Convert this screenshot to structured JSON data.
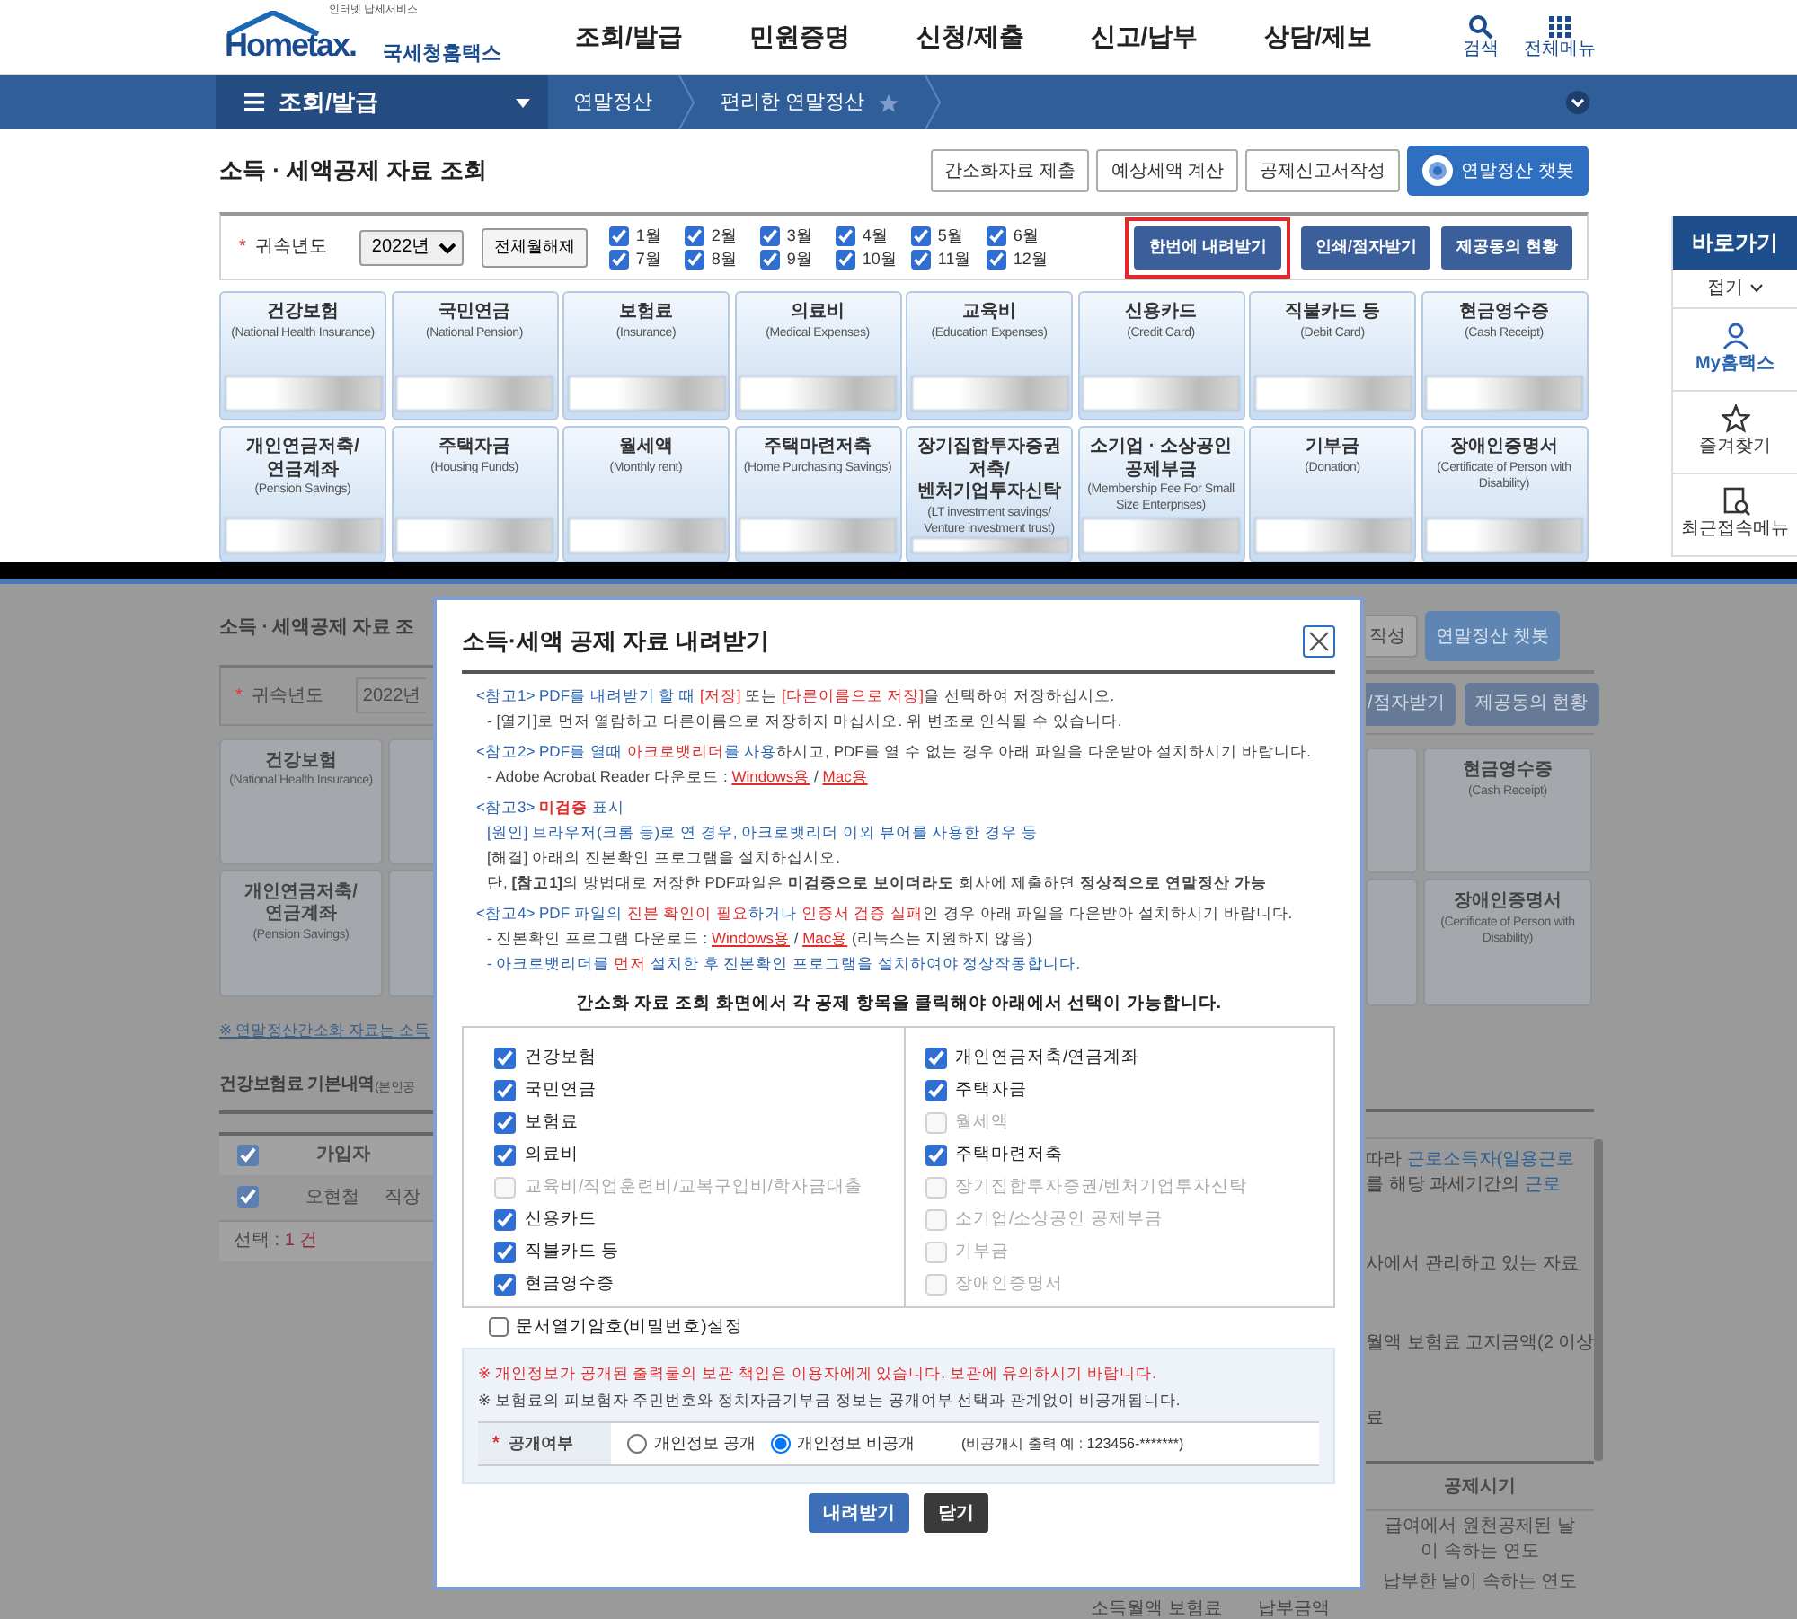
{
  "header": {
    "tagline": "인터넷 납세서비스",
    "logo": "Hometax.",
    "logo_korean": "국세청홈택스",
    "menu": [
      "조회/발급",
      "민원증명",
      "신청/제출",
      "신고/납부",
      "상담/제보"
    ],
    "utilities": [
      {
        "label": "검색",
        "kind": "search"
      },
      {
        "label": "전체메뉴",
        "kind": "grid"
      }
    ]
  },
  "nav": {
    "section": "조회/발급",
    "breadcrumbs": [
      "연말정산",
      "편리한 연말정산"
    ]
  },
  "page": {
    "title": "소득 · 세액공제 자료 조회",
    "actions": [
      {
        "label": "간소화자료 제출",
        "kind": "plain"
      },
      {
        "label": "예상세액 계산",
        "kind": "plain"
      },
      {
        "label": "공제신고서작성",
        "kind": "plain"
      },
      {
        "label": "연말정산 챗봇",
        "kind": "chatbot"
      }
    ],
    "filter": {
      "required_mark": "*",
      "label": "귀속년도",
      "year": "2022년",
      "clear_button": "전체월해제",
      "months": [
        {
          "label": "1월",
          "checked": true
        },
        {
          "label": "2월",
          "checked": true
        },
        {
          "label": "3월",
          "checked": true
        },
        {
          "label": "4월",
          "checked": true
        },
        {
          "label": "5월",
          "checked": true
        },
        {
          "label": "6월",
          "checked": true
        },
        {
          "label": "7월",
          "checked": true
        },
        {
          "label": "8월",
          "checked": true
        },
        {
          "label": "9월",
          "checked": true
        },
        {
          "label": "10월",
          "checked": true
        },
        {
          "label": "11월",
          "checked": true
        },
        {
          "label": "12월",
          "checked": true
        }
      ],
      "buttons": [
        {
          "label": "한번에 내려받기",
          "highlighted": true
        },
        {
          "label": "인쇄/점자받기",
          "highlighted": false
        },
        {
          "label": "제공동의 현황",
          "highlighted": false
        }
      ]
    },
    "categories": [
      {
        "title": "건강보험",
        "subtitle": "(National Health Insurance)"
      },
      {
        "title": "국민연금",
        "subtitle": "(National Pension)"
      },
      {
        "title": "보험료",
        "subtitle": "(Insurance)"
      },
      {
        "title": "의료비",
        "subtitle": "(Medical Expenses)"
      },
      {
        "title": "교육비",
        "subtitle": "(Education Expenses)"
      },
      {
        "title": "신용카드",
        "subtitle": "(Credit Card)"
      },
      {
        "title": "직불카드 등",
        "subtitle": "(Debit Card)"
      },
      {
        "title": "현금영수증",
        "subtitle": "(Cash Receipt)"
      },
      {
        "title": "개인연금저축/\n연금계좌",
        "subtitle": "(Pension Savings)"
      },
      {
        "title": "주택자금",
        "subtitle": "(Housing Funds)"
      },
      {
        "title": "월세액",
        "subtitle": "(Monthly rent)"
      },
      {
        "title": "주택마련저축",
        "subtitle": "(Home Purchasing Savings)"
      },
      {
        "title": "장기집합투자증권저축/\n벤처기업투자신탁",
        "subtitle": "(LT investment savings/ Venture investment trust)"
      },
      {
        "title": "소기업 · 소상공인\n공제부금",
        "subtitle": "(Membership Fee For Small Size Enterprises)"
      },
      {
        "title": "기부금",
        "subtitle": "(Donation)"
      },
      {
        "title": "장애인증명서",
        "subtitle": "(Certificate of Person with Disability)"
      }
    ]
  },
  "quick_menu": {
    "title": "바로가기",
    "collapse": "접기",
    "items": [
      {
        "label": "My홈택스",
        "kind": "person",
        "selected": true
      },
      {
        "label": "즐겨찾기",
        "kind": "star",
        "selected": false
      },
      {
        "label": "최근접속메뉴",
        "kind": "recent",
        "selected": false
      }
    ]
  },
  "background": {
    "left": {
      "title": "소득 · 세액공제 자료 조",
      "required_mark": "*",
      "year_label": "귀속년도",
      "year": "2022년",
      "cards": [
        {
          "title": "건강보험",
          "subtitle": "(National Health Insurance)"
        },
        {
          "title": "개인연금저축/\n연금계좌",
          "subtitle": "(Pension Savings)"
        }
      ],
      "notice_link": "※ 연말정산간소화 자료는 소득",
      "section_title": "건강보험료 기본내역",
      "section_note": "(본인공",
      "table": {
        "header_checked": true,
        "columns": [
          "가입자"
        ],
        "rows": [
          {
            "checked": true,
            "cells": [
              "오현철",
              "직장"
            ]
          }
        ],
        "footer_label": "선택 : ",
        "footer_count": "1 건"
      }
    },
    "right": {
      "actions": [
        "작성",
        "연말정산 챗봇"
      ],
      "filter_buttons": [
        "/점자받기",
        "제공동의 현황"
      ],
      "cards": [
        {
          "title": "현금영수증",
          "subtitle": "(Cash Receipt)"
        },
        {
          "title": "장애인증명서",
          "subtitle": "(Certificate of Person with Disability)"
        }
      ],
      "paragraphs": [
        [
          {
            "text": "따라 ",
            "color": "#444444"
          },
          {
            "text": "근로소득자(일용근로",
            "color": "#2f5f95"
          }
        ],
        [
          {
            "text": "를 해당 과세기간의 ",
            "color": "#444444"
          },
          {
            "text": "근로",
            "color": "#2f5f95"
          }
        ],
        [
          {
            "text": "사에서 관리하고 있는 자료",
            "color": "#444444"
          }
        ],
        [
          {
            "text": "월액 보험료 고지금액(2 이상",
            "color": "#444444"
          }
        ],
        [
          {
            "text": "료",
            "color": "#444444"
          }
        ]
      ],
      "column": "공제시기",
      "cells": [
        "급여에서 원천공제된 날이 속하는 연도",
        "납부한 날이 속하는 연도"
      ]
    },
    "bottom": [
      "소득월액 보험료",
      "납부금액"
    ]
  },
  "modal": {
    "title": "소득·세액 공제 자료 내려받기",
    "notes": [
      [
        [
          {
            "text": "<참고1> PDF를 내려받기 할 때 ",
            "color": "#2a63b0"
          },
          {
            "text": "[저장]",
            "color": "#e02b2b"
          },
          {
            "text": " 또는 ",
            "color": "#444444"
          },
          {
            "text": "[다른이름으로 저장]",
            "color": "#e02b2b"
          },
          {
            "text": "을 선택하여 저장하십시오.",
            "color": "#444444"
          }
        ],
        [
          {
            "text": "- [열기]로 먼저 열람하고 다른이름으로 저장하지 마십시오. 위 변조로 인식될 수 있습니다.",
            "color": "#444444"
          }
        ]
      ],
      [
        [
          {
            "text": "<참고2> PDF를 열때 ",
            "color": "#2a63b0"
          },
          {
            "text": "아크로뱃리더",
            "color": "#e02b2b"
          },
          {
            "text": "를 사용",
            "color": "#2a63b0"
          },
          {
            "text": "하시고, PDF를 열 수 없는 경우 아래 파일을 다운받아 설치하시기 바랍니다.",
            "color": "#444444"
          }
        ],
        [
          {
            "text": "- Adobe Acrobat Reader 다운로드 : ",
            "color": "#444444"
          },
          {
            "text": "Windows용",
            "color": "#e02b2b",
            "link": true
          },
          {
            "text": " / ",
            "color": "#444444"
          },
          {
            "text": "Mac용",
            "color": "#e02b2b",
            "link": true
          }
        ]
      ],
      [
        [
          {
            "text": "<참고3> ",
            "color": "#2a63b0"
          },
          {
            "text": "미검증",
            "color": "#e02b2b",
            "bold": true
          },
          {
            "text": " 표시",
            "color": "#2a63b0"
          }
        ],
        [
          {
            "text": "[원인] 브라우저(크롬 등)로 연 경우, 아크로뱃리더 이외 뷰어를 사용한 경우 등",
            "color": "#2a63b0"
          }
        ],
        [
          {
            "text": "[해결] 아래의 진본확인 프로그램을 설치하십시오.",
            "color": "#444444"
          }
        ],
        [
          {
            "text": "단, ",
            "color": "#444444"
          },
          {
            "text": "[참고1]",
            "color": "#444444",
            "bold": true
          },
          {
            "text": "의 방법대로 저장한 PDF파일은 ",
            "color": "#444444"
          },
          {
            "text": "미검증으로 보이더라도",
            "color": "#444444",
            "bold": true
          },
          {
            "text": " 회사에 제출하면 ",
            "color": "#444444"
          },
          {
            "text": "정상적으로 연말정산 가능",
            "color": "#444444",
            "bold": true
          }
        ]
      ],
      [
        [
          {
            "text": "<참고4> PDF 파일의 ",
            "color": "#2a63b0"
          },
          {
            "text": "진본 확인이 필요",
            "color": "#e02b2b"
          },
          {
            "text": "하거나 ",
            "color": "#2a63b0"
          },
          {
            "text": "인증서 검증 실패",
            "color": "#e02b2b"
          },
          {
            "text": "인 경우 아래 파일을 다운받아 설치하시기 바랍니다.",
            "color": "#444444"
          }
        ],
        [
          {
            "text": "- 진본확인 프로그램 다운로드 : ",
            "color": "#444444"
          },
          {
            "text": "Windows용",
            "color": "#e02b2b",
            "link": true
          },
          {
            "text": " / ",
            "color": "#444444"
          },
          {
            "text": "Mac용",
            "color": "#e02b2b",
            "link": true
          },
          {
            "text": " (리눅스는 지원하지 않음)",
            "color": "#444444"
          }
        ],
        [
          {
            "text": "- 아크로뱃리더를 ",
            "color": "#2a63b0"
          },
          {
            "text": "먼저",
            "color": "#e02b2b"
          },
          {
            "text": " 설치한 후 진본확인 프로그램을 설치하여야 정상작동합니다.",
            "color": "#2a63b0"
          }
        ]
      ]
    ],
    "instruction": "간소화 자료 조회 화면에서 각 공제 항목을 클릭해야 아래에서 선택이 가능합니다.",
    "columns": [
      [
        {
          "label": "건강보험",
          "checked": true,
          "disabled": false
        },
        {
          "label": "국민연금",
          "checked": true,
          "disabled": false
        },
        {
          "label": "보험료",
          "checked": true,
          "disabled": false
        },
        {
          "label": "의료비",
          "checked": true,
          "disabled": false
        },
        {
          "label": "교육비/직업훈련비/교복구입비/학자금대출",
          "checked": false,
          "disabled": true
        },
        {
          "label": "신용카드",
          "checked": true,
          "disabled": false
        },
        {
          "label": "직불카드 등",
          "checked": true,
          "disabled": false
        },
        {
          "label": "현금영수증",
          "checked": true,
          "disabled": false
        }
      ],
      [
        {
          "label": "개인연금저축/연금계좌",
          "checked": true,
          "disabled": false
        },
        {
          "label": "주택자금",
          "checked": true,
          "disabled": false
        },
        {
          "label": "월세액",
          "checked": false,
          "disabled": true
        },
        {
          "label": "주택마련저축",
          "checked": true,
          "disabled": false
        },
        {
          "label": "장기집합투자증권/벤처기업투자신탁",
          "checked": false,
          "disabled": true
        },
        {
          "label": "소기업/소상공인 공제부금",
          "checked": false,
          "disabled": true
        },
        {
          "label": "기부금",
          "checked": false,
          "disabled": true
        },
        {
          "label": "장애인증명서",
          "checked": false,
          "disabled": true
        }
      ]
    ],
    "password_option": {
      "label": "문서열기암호(비밀번호)설정",
      "checked": false
    },
    "warnings": [
      {
        "text": "※ 개인정보가 공개된 출력물의 보관 책임은 이용자에게 있습니다. 보관에 유의하시기 바랍니다.",
        "color": "#e02b2b"
      },
      {
        "text": "※ 보험료의 피보험자 주민번호와 정치자금기부금 정보는 공개여부 선택과 관계없이 비공개됩니다.",
        "color": "#444444"
      }
    ],
    "disclosure": {
      "required_mark": "*",
      "label": "공개여부",
      "options": [
        {
          "label": "개인정보 공개",
          "selected": false
        },
        {
          "label": "개인정보 비공개",
          "selected": true
        }
      ],
      "example": "(비공개시 출력 예 : 123456-*******)"
    },
    "buttons": [
      {
        "label": "내려받기",
        "kind": "primary"
      },
      {
        "label": "닫기",
        "kind": "dark"
      }
    ]
  }
}
